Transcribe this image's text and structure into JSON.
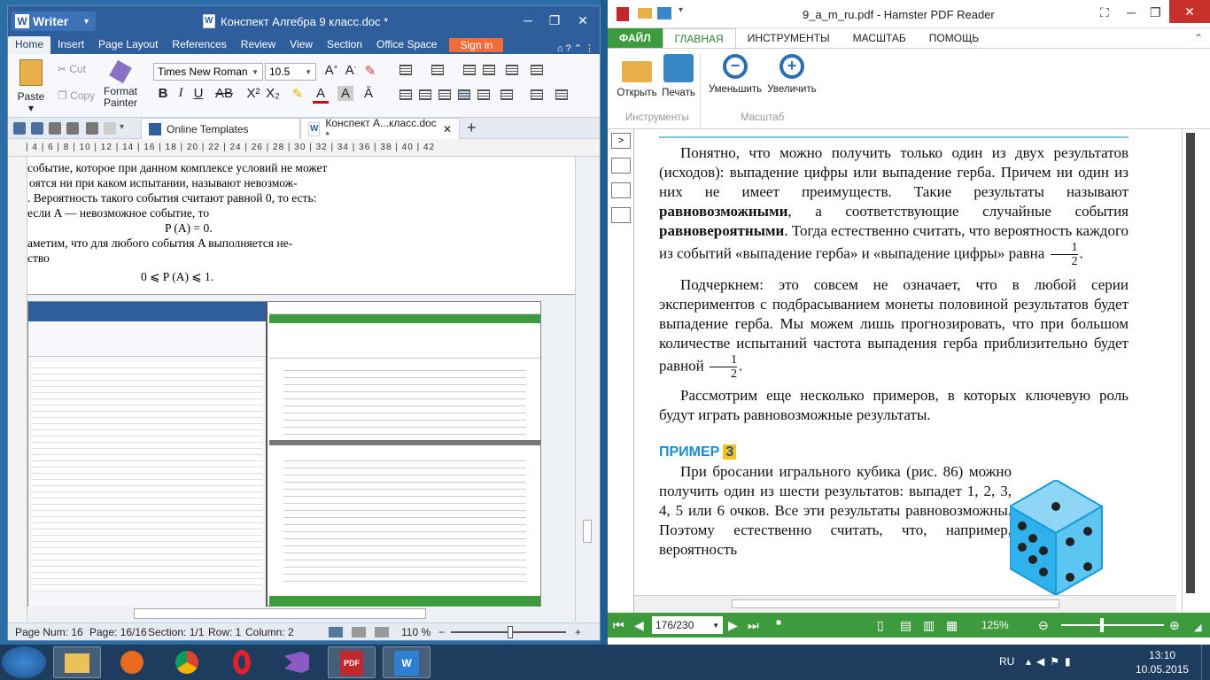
{
  "writer": {
    "app_name": "Writer",
    "title": "Конспект Алгебра 9 класс.doc *",
    "menu": [
      "Home",
      "Insert",
      "Page Layout",
      "References",
      "Review",
      "View",
      "Section",
      "Office Space"
    ],
    "signin": "Sign in",
    "ribbon": {
      "paste": "Paste",
      "cut": "Cut",
      "copy": "Copy",
      "format_painter_1": "Format",
      "format_painter_2": "Painter",
      "font": "Times New Roman",
      "size": "10.5"
    },
    "tabs": {
      "online": "Online Templates",
      "doc": "Конспект А...класс.doc *"
    },
    "ruler": "| 4 | 6 | 8 | 10 | 12 | 14 | 16 | 18 | 20 | 22 | 24 | 26 | 28 | 30 | 32 | 34 | 36 | 38 | 40 | 42",
    "page_lines": [
      "событие, которое при данном комплексе условий не может",
      "оятся ни при каком испытании, называют невозмож-",
      ". Вероятность такого события считают равной 0, то есть:",
      "если A — невозможное событие, то",
      "P (A) = 0.",
      "аметим, что для любого события A выполняется не-",
      "ство",
      "0 ⩽ P (A) ⩽ 1."
    ],
    "status": {
      "page_num": "Page Num: 16",
      "page": "Page: 16/16",
      "section": "Section: 1/1",
      "row": "Row: 1",
      "column": "Column: 2",
      "zoom": "110 %"
    }
  },
  "pdf": {
    "title": "9_a_m_ru.pdf - Hamster PDF Reader",
    "tabs": [
      "ФАЙЛ",
      "ГЛАВНАЯ",
      "ИНСТРУМЕНТЫ",
      "МАСШТАБ",
      "ПОМОЩЬ"
    ],
    "buttons": {
      "open": "Открыть",
      "print": "Печать",
      "zoom_out": "Уменьшить",
      "zoom_in": "Увеличить"
    },
    "groups": {
      "tools": "Инструменты",
      "zoom": "Масштаб"
    },
    "para1_a": "Понятно, что можно получить только один из двух результатов (исходов): выпадение цифры или выпадение герба. Причем ни один из них не имеет преимуществ. Такие результаты называют ",
    "para1_b": "равновозможными",
    "para1_c": ", а соответствующие случайные события ",
    "para1_d": "равновероятными",
    "para1_e": ". Тогда естественно считать, что вероятность каждого из событий «выпадение герба» и «выпадение цифры» равна ",
    "para2": "Подчеркнем: это совсем не означает, что в любой серии экспериментов с подбрасыванием монеты половиной результатов будет выпадение герба. Мы можем лишь прогнозировать, что при большом количестве испытаний частота выпадения герба приблизительно будет равной ",
    "para3": "Рассмотрим еще несколько примеров, в которых ключевую роль будут играть равновозможные результаты.",
    "example_label": "ПРИМЕР",
    "example_num": "3",
    "para4": "При бросании игрального кубика (рис. 86) можно получить один из шести результатов: выпадет 1, 2, 3, 4, 5 или 6 очков. Все эти результаты равновозможны. Поэтому естественно считать, что, например, вероятность",
    "frac_num": "1",
    "frac_den": "2",
    "page_box": "176/230",
    "zoom": "125%"
  },
  "taskbar": {
    "lang": "RU",
    "time": "13:10",
    "date": "10.05.2015"
  },
  "colors": {
    "writer_blue": "#2e5f9c",
    "pdf_green": "#3d9a3d",
    "accent_orange": "#f26b3a"
  }
}
